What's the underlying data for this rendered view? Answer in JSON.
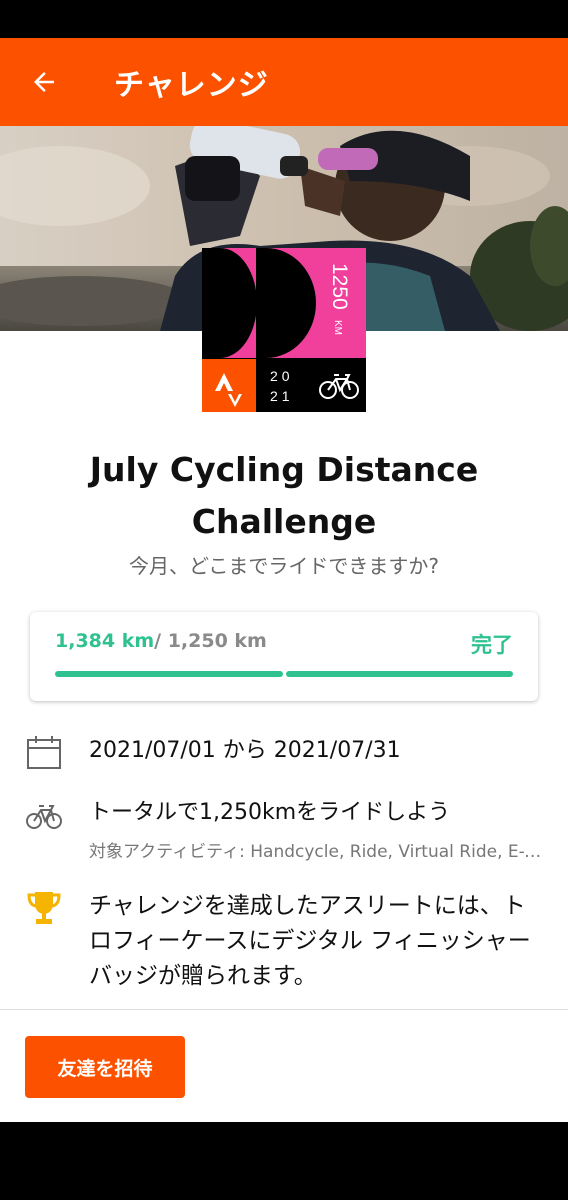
{
  "appbar": {
    "title": "チャレンジ"
  },
  "badge": {
    "distance": "1250",
    "unit": "KM",
    "year_top": "20",
    "year_bottom": "21"
  },
  "challenge": {
    "title": "July Cycling Distance Challenge",
    "subtitle": "今月、どこまでライドできますか?"
  },
  "progress": {
    "current": "1,384 km",
    "total": "/ 1,250 km",
    "status": "完了",
    "fraction": 1.0
  },
  "details": {
    "dates": "2021/07/01 から 2021/07/31",
    "goal": "トータルで1,250kmをライドしよう",
    "activities": "対象アクティビティ: Handcycle, Ride, Virtual Ride, E-Bike Ride",
    "reward": "チャレンジを達成したアスリートには、トロフィーケースにデジタル フィニッシャーバッジが贈られます。"
  },
  "actions": {
    "invite": "友達を招待"
  },
  "colors": {
    "brand": "#fc5200",
    "complete": "#2fc28f",
    "badge_pink": "#f0409b",
    "trophy": "#f5b400"
  }
}
